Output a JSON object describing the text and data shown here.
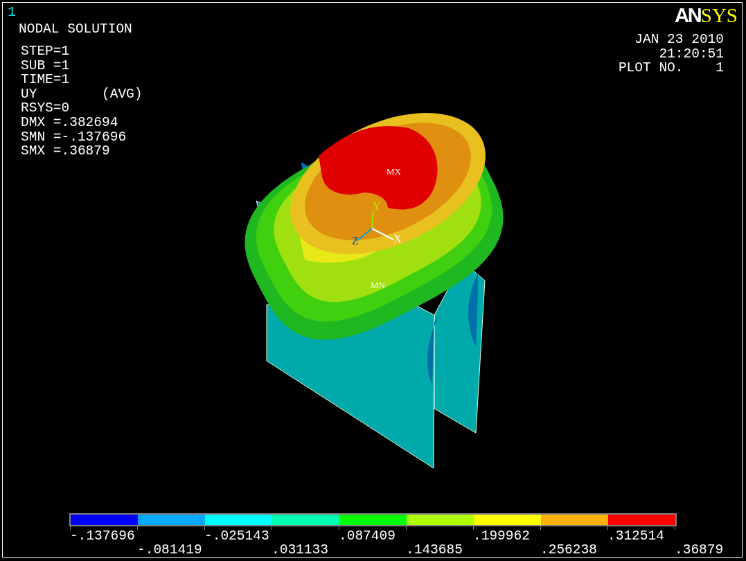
{
  "window": {
    "number": "1"
  },
  "title": "NODAL SOLUTION",
  "info_lines": [
    "STEP=1",
    "SUB =1",
    "TIME=1",
    "UY        (AVG)",
    "RSYS=0",
    "DMX =.382694",
    "SMN =-.137696",
    "SMX =.36879"
  ],
  "logo": {
    "bold_part": "AN",
    "serif_part": "SYS"
  },
  "stamp": [
    "JAN 23 2010",
    "21:20:51",
    "PLOT NO.    1"
  ],
  "model": {
    "max_label": "MX",
    "min_label": "MN",
    "axes": {
      "x": "X",
      "y": "Y",
      "z": "Z"
    }
  },
  "legend": {
    "bands": [
      {
        "color": "#0000ff"
      },
      {
        "color": "#00a8ff"
      },
      {
        "color": "#00ffff"
      },
      {
        "color": "#00ffb0"
      },
      {
        "color": "#00ff00"
      },
      {
        "color": "#b0ff00"
      },
      {
        "color": "#ffff00"
      },
      {
        "color": "#ffb000"
      },
      {
        "color": "#ff0000"
      }
    ],
    "labels": [
      "-.137696",
      "-.081419",
      "-.025143",
      ".031133",
      ".087409",
      ".143685",
      ".199962",
      ".256238",
      ".312514",
      ".36879"
    ]
  }
}
